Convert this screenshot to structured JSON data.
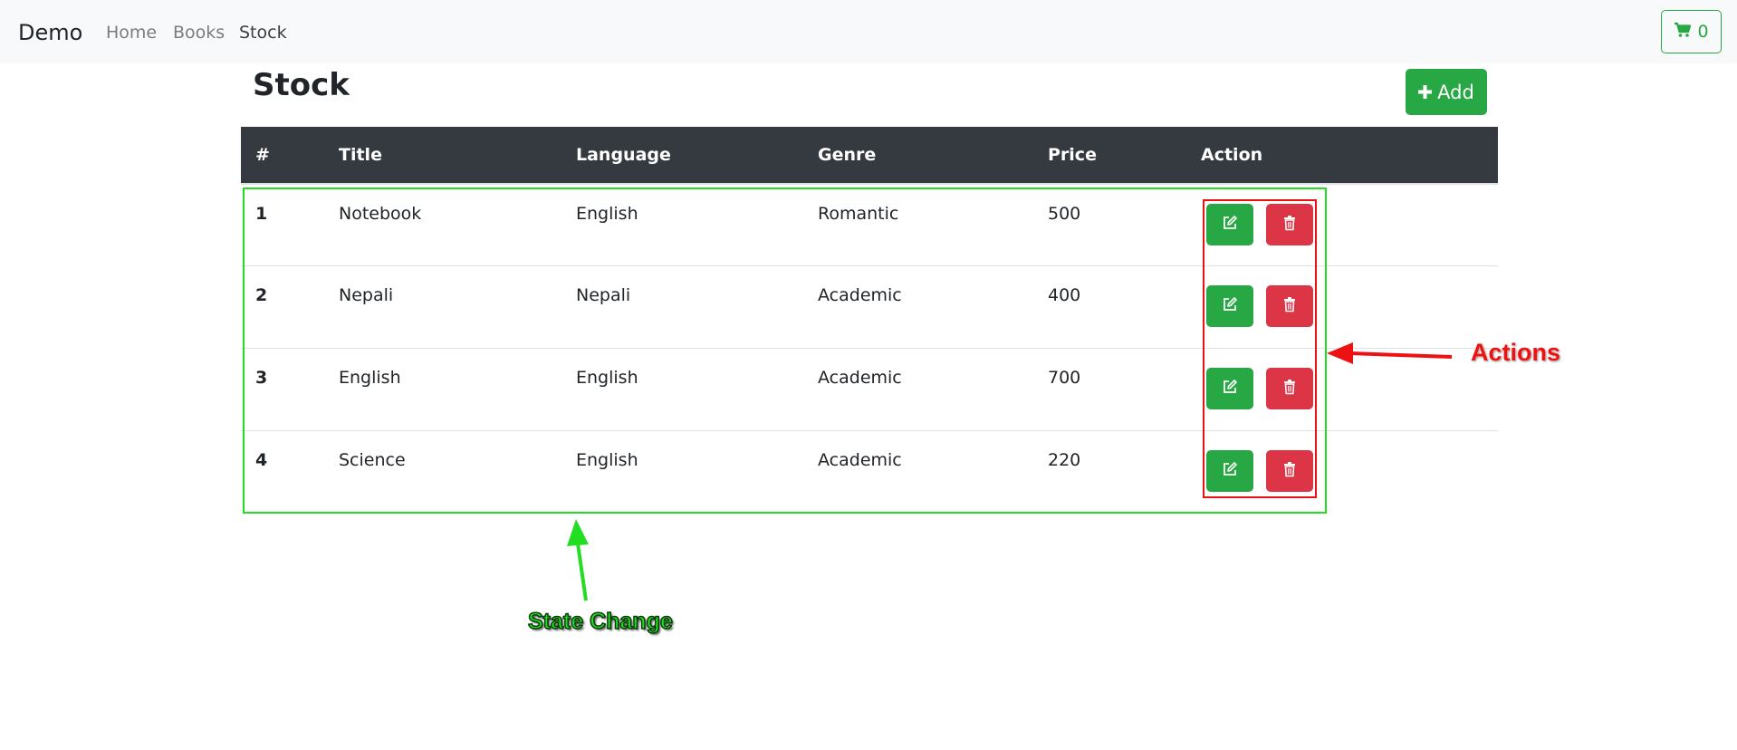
{
  "navbar": {
    "brand": "Demo",
    "links": [
      {
        "label": "Home"
      },
      {
        "label": "Books"
      },
      {
        "label": "Stock"
      }
    ],
    "cart": {
      "icon": "cart-icon",
      "count": "0"
    }
  },
  "page": {
    "title": "Stock",
    "add_label": "Add",
    "add_icon": "plus-icon"
  },
  "table": {
    "headers": [
      "#",
      "Title",
      "Language",
      "Genre",
      "Price",
      "Action"
    ],
    "rows": [
      {
        "num": "1",
        "title": "Notebook",
        "language": "English",
        "genre": "Romantic",
        "price": "500"
      },
      {
        "num": "2",
        "title": "Nepali",
        "language": "Nepali",
        "genre": "Academic",
        "price": "400"
      },
      {
        "num": "3",
        "title": "English",
        "language": "English",
        "genre": "Academic",
        "price": "700"
      },
      {
        "num": "4",
        "title": "Science",
        "language": "English",
        "genre": "Academic",
        "price": "220"
      }
    ],
    "row_actions": {
      "edit_icon": "edit-icon",
      "delete_icon": "trash-icon"
    }
  },
  "annotations": {
    "actions_label": "Actions",
    "state_change_label": "State Change"
  },
  "colors": {
    "success": "#28a745",
    "danger": "#dc3545",
    "table_header_bg": "#343a40",
    "navbar_bg": "#f8f9fa",
    "annotation_green": "#22dd22",
    "annotation_red": "#ee1111"
  }
}
